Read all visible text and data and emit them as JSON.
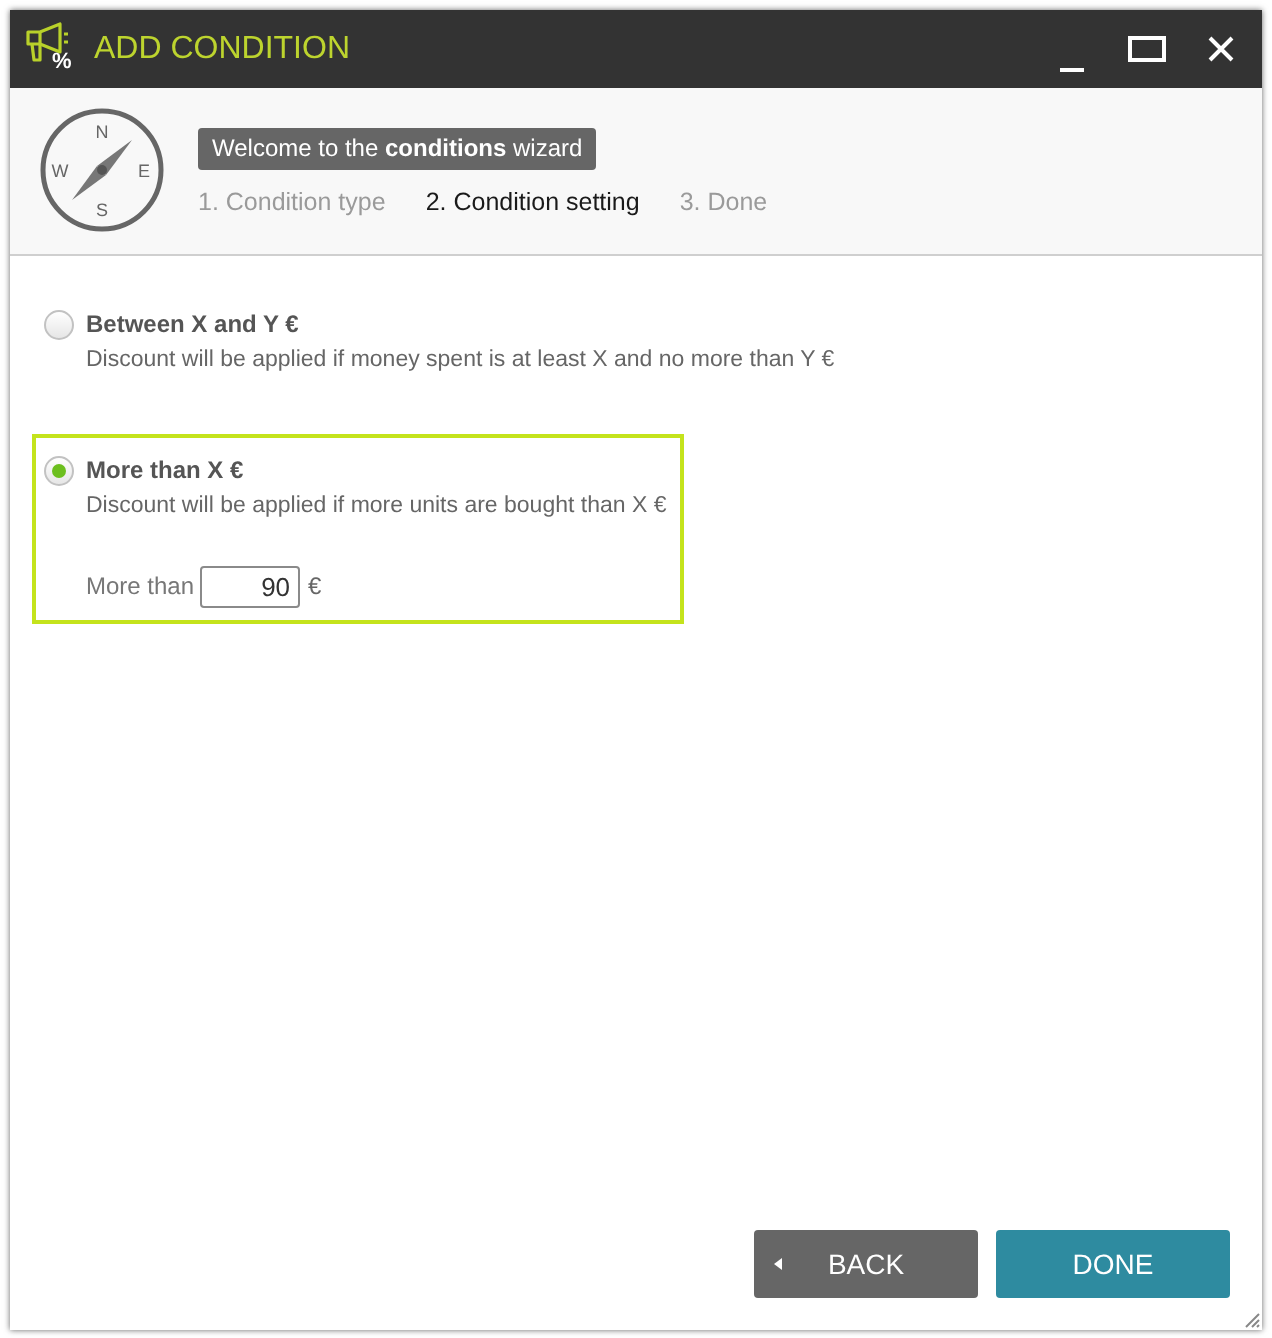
{
  "window": {
    "title": "ADD CONDITION",
    "icon_symbol": "%"
  },
  "wizard": {
    "compass_letters": {
      "north": "N",
      "east": "E",
      "south": "S",
      "west": "W"
    },
    "welcome": "Welcome to the **conditions** wizard",
    "steps": [
      {
        "label": "1. Condition type",
        "selected": false
      },
      {
        "label": "2. Condition setting",
        "selected": true
      },
      {
        "label": "3. Done",
        "selected": false
      }
    ]
  },
  "options": [
    {
      "title": "Between X and Y €",
      "description": "Discount will be applied if money spent is at least X and no more than Y €",
      "selected": false
    },
    {
      "title": "More than X €",
      "description": "Discount will be applied if more units are bought than X €",
      "selected": true,
      "field": {
        "label": "More than",
        "value": "90",
        "unit": "€"
      }
    }
  ],
  "buttons": [
    {
      "kind": "back",
      "label": "BACK"
    },
    {
      "kind": "primary",
      "label": "DONE"
    }
  ]
}
